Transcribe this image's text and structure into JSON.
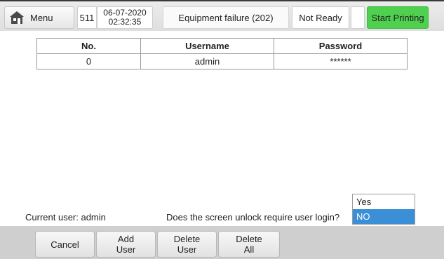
{
  "header": {
    "menu_label": "Menu",
    "menu_icon": "house-icon",
    "code": "511",
    "date": "06-07-2020",
    "time": "02:32:35",
    "status": "Equipment failure (202)",
    "ready_state": "Not Ready",
    "start_label": "Start Printing"
  },
  "table": {
    "headers": [
      "No.",
      "Username",
      "Password"
    ],
    "rows": [
      {
        "no": "0",
        "username": "admin",
        "password": "******"
      }
    ]
  },
  "info": {
    "current_user": "Current user: admin",
    "unlock_question": "Does the screen unlock require user login?"
  },
  "dropdown": {
    "options": [
      "Yes",
      "NO"
    ],
    "selected": "NO"
  },
  "footer": {
    "cancel": "Cancel",
    "add_user": "Add\nUser",
    "delete_user": "Delete\nUser",
    "delete_all": "Delete\nAll"
  },
  "colors": {
    "start_button": "#4fd14f",
    "selected_option": "#3b8fd6",
    "footer_bg": "#cfcfcf"
  }
}
